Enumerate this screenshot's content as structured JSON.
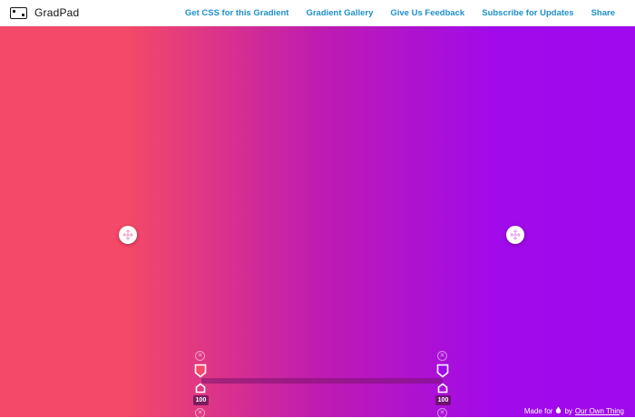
{
  "app": {
    "name": "GradPad"
  },
  "nav": [
    {
      "label": "Get CSS for this Gradient"
    },
    {
      "label": "Gradient Gallery"
    },
    {
      "label": "Give Us Feedback"
    },
    {
      "label": "Subscribe for Updates"
    },
    {
      "label": "Share"
    }
  ],
  "gradient": {
    "colors": {
      "start": "#f44968",
      "middle": "#bf1cb0",
      "end": "#a008ee"
    },
    "stops": [
      {
        "value": "100"
      },
      {
        "value": "100"
      }
    ]
  },
  "footer": {
    "made_for": "Made for",
    "by": "by",
    "link": "Our Own Thing"
  },
  "colors": {
    "link": "#1e90c8"
  }
}
